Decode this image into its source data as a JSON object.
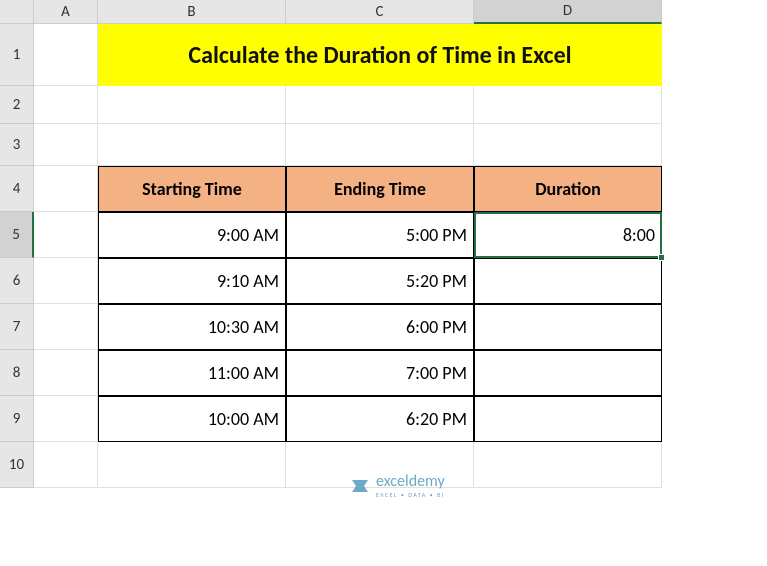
{
  "columns": [
    "A",
    "B",
    "C",
    "D"
  ],
  "rows": [
    "1",
    "2",
    "3",
    "4",
    "5",
    "6",
    "7",
    "8",
    "9",
    "10"
  ],
  "title": "Calculate the Duration of Time in Excel",
  "headers": {
    "starting": "Starting Time",
    "ending": "Ending Time",
    "duration": "Duration"
  },
  "chart_data": {
    "type": "table",
    "columns": [
      "Starting Time",
      "Ending Time",
      "Duration"
    ],
    "rows": [
      {
        "starting": "9:00 AM",
        "ending": "5:00 PM",
        "duration": "8:00"
      },
      {
        "starting": "9:10 AM",
        "ending": "5:20 PM",
        "duration": ""
      },
      {
        "starting": "10:30 AM",
        "ending": "6:00 PM",
        "duration": ""
      },
      {
        "starting": "11:00 AM",
        "ending": "7:00 PM",
        "duration": ""
      },
      {
        "starting": "10:00 AM",
        "ending": "6:20 PM",
        "duration": ""
      }
    ]
  },
  "selected": {
    "col": "D",
    "row": "5"
  },
  "watermark": {
    "name": "exceldemy",
    "tagline": "EXCEL • DATA • BI"
  }
}
